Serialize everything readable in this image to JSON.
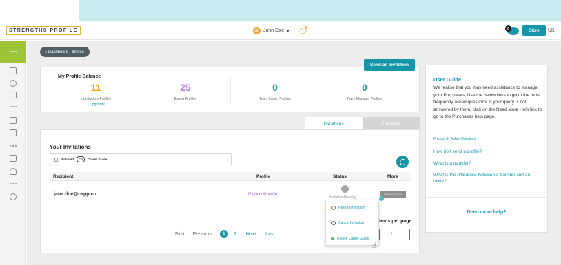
{
  "header": {
    "logo_text": "STRENGTHS·PROFILE",
    "user_initials": "JD",
    "user_name": "John Doe",
    "user_caret": "▾",
    "cart_count": "0",
    "store_label": "Store",
    "language": "UK"
  },
  "breadcrumb": "‹ Dashboard - Invites",
  "send_invitation_label": "Send an invitation",
  "balance": {
    "title": "My Profile Balance",
    "items": [
      {
        "value": "11",
        "label": "Introductory Profiles",
        "sub": "1 Upgrades",
        "color": "#f0a81c"
      },
      {
        "value": "25",
        "label": "Expert Profiles",
        "sub": "",
        "color": "#b57be0"
      },
      {
        "value": "0",
        "label": "Team Expert Profiles",
        "sub": "",
        "color": "#1596a8"
      },
      {
        "value": "0",
        "label": "Team Manager Profiles",
        "sub": "",
        "color": "#1596a8"
      }
    ]
  },
  "tabs": {
    "invitations": "Invitations",
    "transfers": "Transfers"
  },
  "invitations": {
    "title": "Your Invitations",
    "filter_org": "Withheld",
    "filter_badge": "CG",
    "filter_label": "Career Guide",
    "columns": {
      "recipient": "Recipient",
      "profile": "Profile",
      "status": "Status",
      "more": "More"
    },
    "row": {
      "email": "jane.doe@capp.co",
      "profile": "Expert Profile",
      "status": "Invitation Pending",
      "more_label": "More Options"
    },
    "dropdown": [
      "Resend Invitation",
      "Cancel Invitation",
      "Unlock Career Guide"
    ],
    "pagination": {
      "first": "First",
      "previous": "Previous",
      "current": "1",
      "page2": "2",
      "next": "Next",
      "last": "Last"
    },
    "items_per_page_label": "Items per page",
    "items_per_page_value": "1"
  },
  "guide": {
    "title": "User Guide",
    "text": "We realise that you may need assistance to manage your Purchases. Use the below links to go to the most frequently asked questions. If your query is not answered by them, click on the Need More Help link to go to the Purchases help page.",
    "faq_label": "Frequently Asked Questions",
    "links": [
      "How do I send a profile?",
      "What is a transfer?",
      "What is the difference between a transfer and an invite?"
    ],
    "help_link": "Need more help?"
  },
  "colors": {
    "accent": "#1596a8",
    "sidebar_active": "#9dc537",
    "expert": "#b57be0",
    "intro": "#f0a81c"
  }
}
